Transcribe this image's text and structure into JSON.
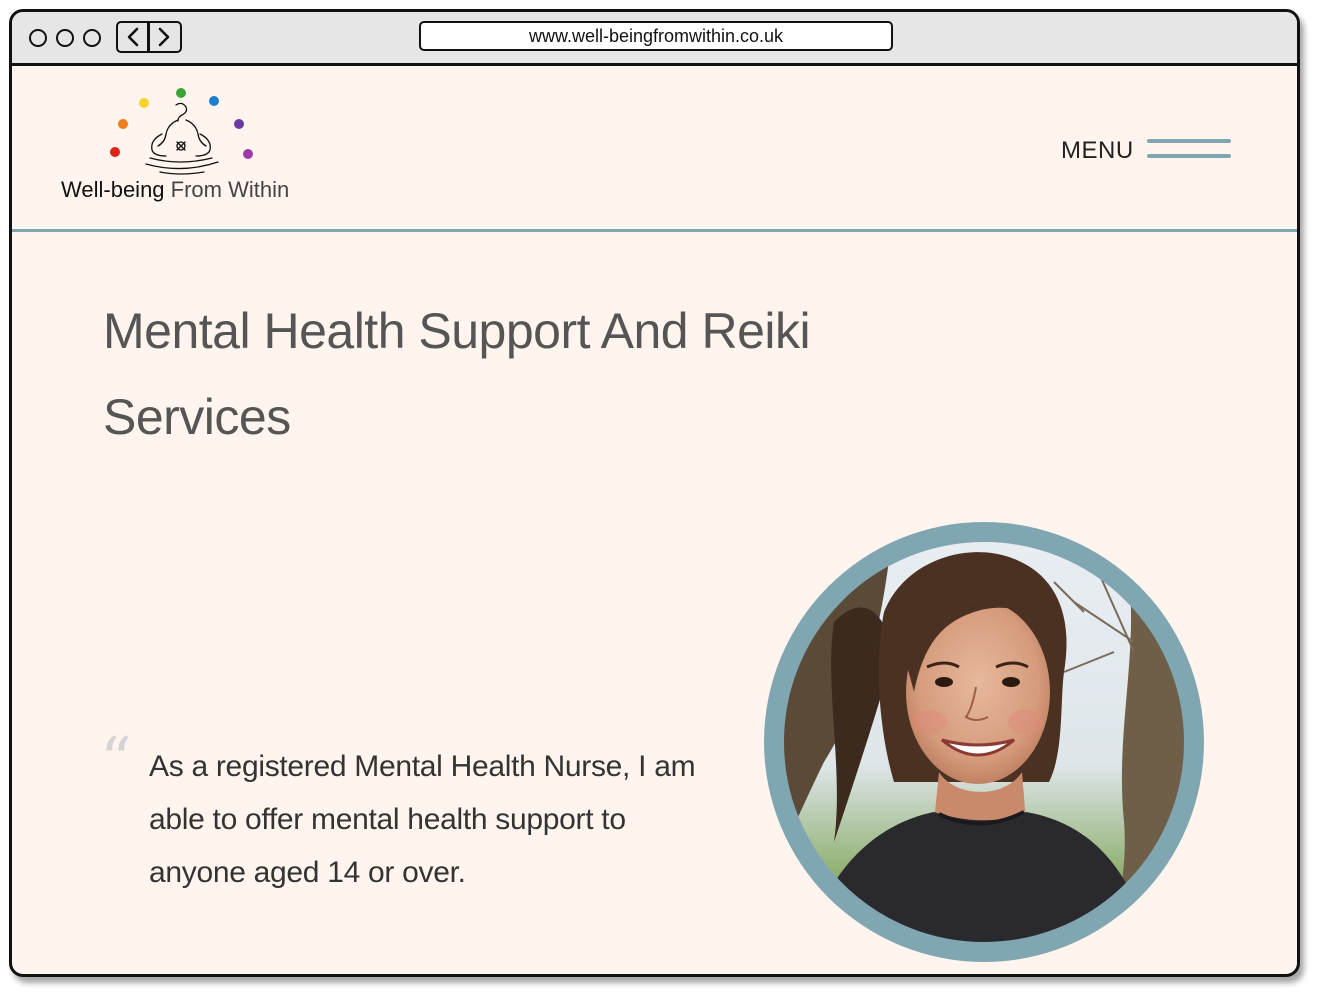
{
  "browser": {
    "url": "www.well-beingfromwithin.co.uk"
  },
  "logo": {
    "name_bold": "Well-being",
    "name_light": "From Within",
    "dot_colors": [
      "#e0211b",
      "#ef7d1a",
      "#f6d42c",
      "#3aa33a",
      "#1a7ed1",
      "#6a3aa0",
      "#9d3aa7"
    ]
  },
  "nav": {
    "menu_label": "MENU"
  },
  "hero": {
    "title": "Mental Health Support And Reiki Services",
    "quote_mark": "“",
    "quote": "As a registered Mental Health Nurse, I am able to offer mental health support to anyone aged 14 or over."
  },
  "colors": {
    "accent": "#7fa6b1",
    "background": "#fff5ee"
  }
}
